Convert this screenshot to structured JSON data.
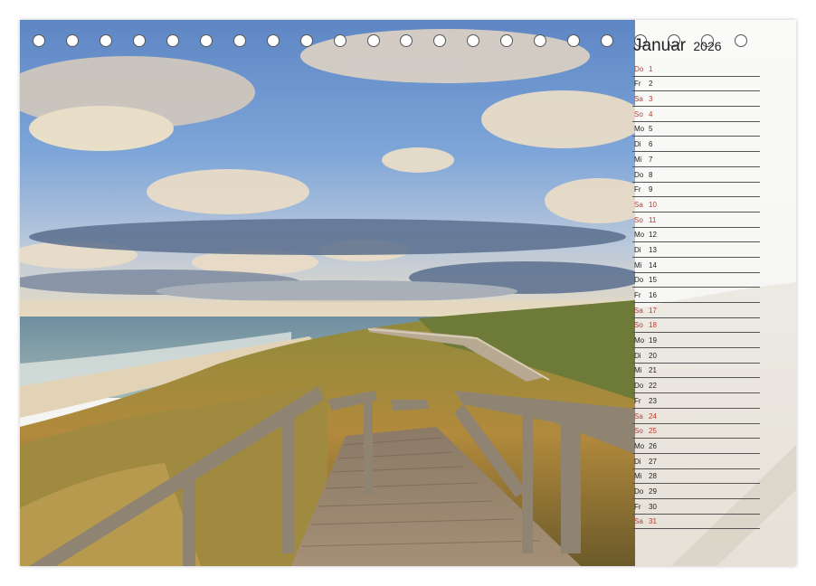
{
  "calendar": {
    "month": "Januar",
    "year": "2026",
    "ring_holes": 22,
    "weekend_color": "#c0392b",
    "days": [
      {
        "wd": "Do",
        "d": "1",
        "weekend": true
      },
      {
        "wd": "Fr",
        "d": "2",
        "weekend": false
      },
      {
        "wd": "Sa",
        "d": "3",
        "weekend": true
      },
      {
        "wd": "So",
        "d": "4",
        "weekend": true
      },
      {
        "wd": "Mo",
        "d": "5",
        "weekend": false
      },
      {
        "wd": "Di",
        "d": "6",
        "weekend": false
      },
      {
        "wd": "Mi",
        "d": "7",
        "weekend": false
      },
      {
        "wd": "Do",
        "d": "8",
        "weekend": false
      },
      {
        "wd": "Fr",
        "d": "9",
        "weekend": false
      },
      {
        "wd": "Sa",
        "d": "10",
        "weekend": true
      },
      {
        "wd": "So",
        "d": "11",
        "weekend": true
      },
      {
        "wd": "Mo",
        "d": "12",
        "weekend": false
      },
      {
        "wd": "Di",
        "d": "13",
        "weekend": false
      },
      {
        "wd": "Mi",
        "d": "14",
        "weekend": false
      },
      {
        "wd": "Do",
        "d": "15",
        "weekend": false
      },
      {
        "wd": "Fr",
        "d": "16",
        "weekend": false
      },
      {
        "wd": "Sa",
        "d": "17",
        "weekend": true
      },
      {
        "wd": "So",
        "d": "18",
        "weekend": true
      },
      {
        "wd": "Mo",
        "d": "19",
        "weekend": false
      },
      {
        "wd": "Di",
        "d": "20",
        "weekend": false
      },
      {
        "wd": "Mi",
        "d": "21",
        "weekend": false
      },
      {
        "wd": "Do",
        "d": "22",
        "weekend": false
      },
      {
        "wd": "Fr",
        "d": "23",
        "weekend": false
      },
      {
        "wd": "Sa",
        "d": "24",
        "weekend": true
      },
      {
        "wd": "So",
        "d": "25",
        "weekend": true
      },
      {
        "wd": "Mo",
        "d": "26",
        "weekend": false
      },
      {
        "wd": "Di",
        "d": "27",
        "weekend": false
      },
      {
        "wd": "Mi",
        "d": "28",
        "weekend": false
      },
      {
        "wd": "Do",
        "d": "29",
        "weekend": false
      },
      {
        "wd": "Fr",
        "d": "30",
        "weekend": false
      },
      {
        "wd": "Sa",
        "d": "31",
        "weekend": true
      }
    ]
  }
}
